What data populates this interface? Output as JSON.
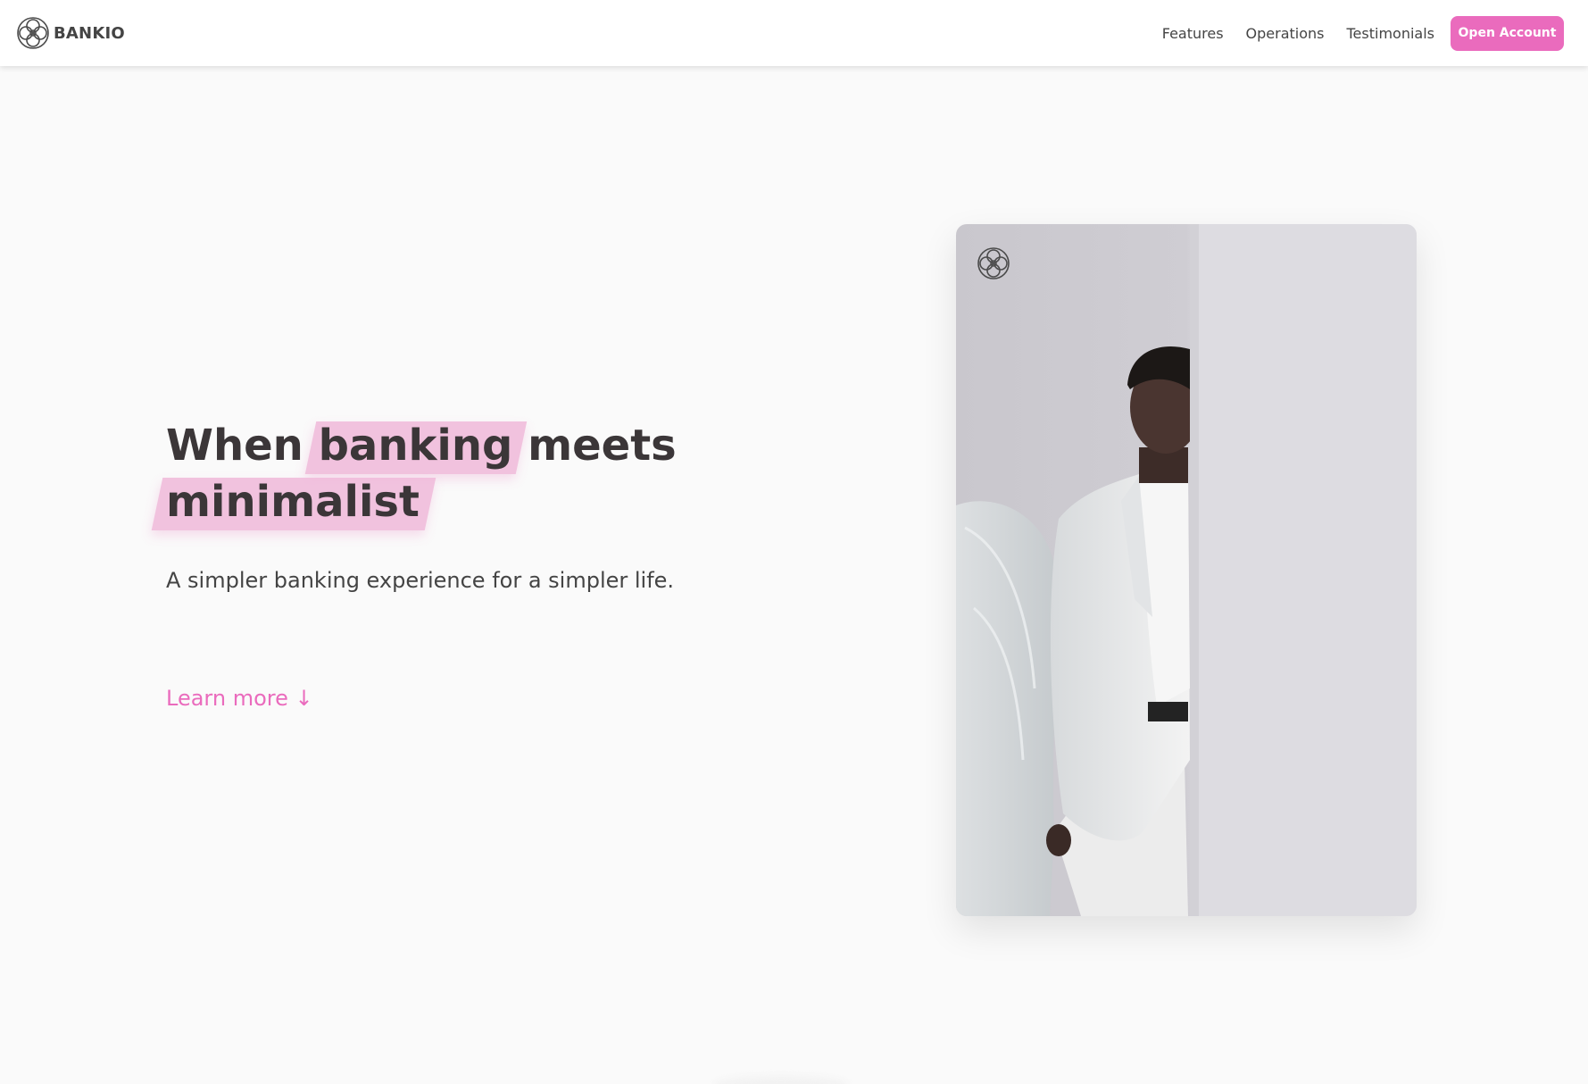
{
  "nav": {
    "brand": "BANKIO",
    "links": [
      "Features",
      "Operations",
      "Testimonials"
    ],
    "cta": "Open Account"
  },
  "hero": {
    "title_when": "When",
    "title_banking": "banking",
    "title_meets": "meets",
    "title_minimalist": "minimalist",
    "subtitle": "A simpler banking experience for a simpler life.",
    "learn_more": "Learn more ↓"
  },
  "colors": {
    "accent": "#ea6bbd",
    "highlight": "#f0b9da",
    "text": "#444444",
    "background": "#fafafa"
  },
  "icons": {
    "brand_logo": "bankio-logo-icon",
    "card_logo": "bankio-logo-icon"
  }
}
